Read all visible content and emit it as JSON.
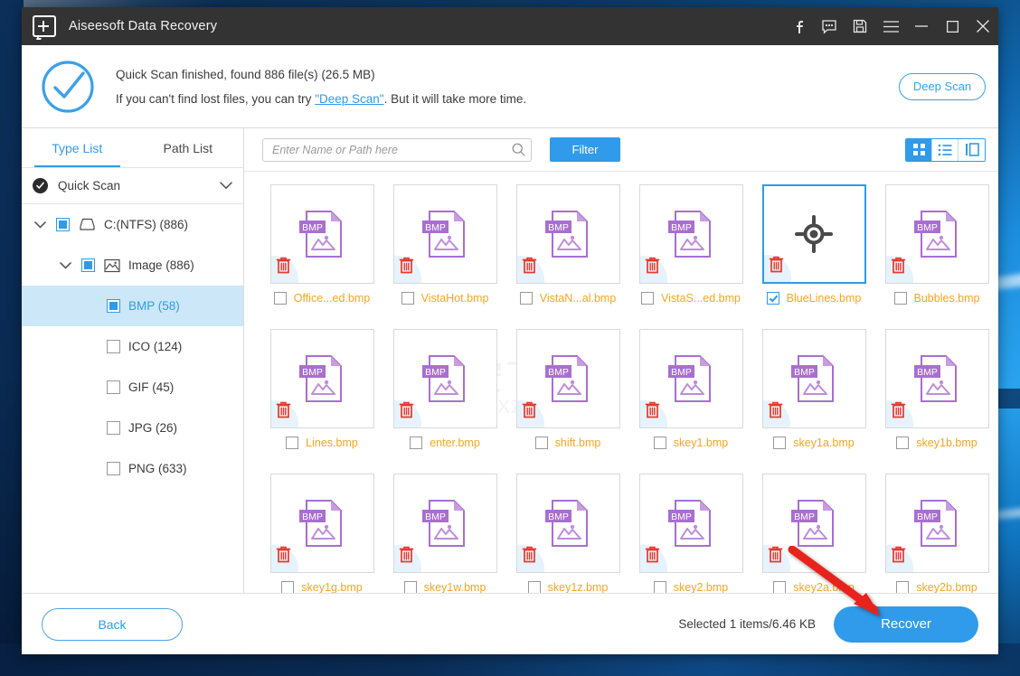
{
  "window": {
    "title": "Aiseesoft Data Recovery",
    "logo_icon": "app-plus-icon",
    "titlebar_buttons": [
      {
        "name": "facebook-icon",
        "label": "f"
      },
      {
        "name": "feedback-icon",
        "label": ""
      },
      {
        "name": "save-icon",
        "label": ""
      },
      {
        "name": "menu-icon",
        "label": ""
      },
      {
        "name": "minimize-icon",
        "label": ""
      },
      {
        "name": "maximize-icon",
        "label": ""
      },
      {
        "name": "close-icon",
        "label": ""
      }
    ]
  },
  "status": {
    "check_icon": "check-circle-icon",
    "line1": "Quick Scan finished, found 886 file(s) (26.5 MB)",
    "line2_before": "If you can't find lost files, you can try ",
    "line2_link": "\"Deep Scan\"",
    "line2_after": ". But it will take more time.",
    "deep_scan_button": "Deep Scan"
  },
  "sidebar": {
    "tabs": [
      {
        "label": "Type List",
        "active": true
      },
      {
        "label": "Path List",
        "active": false
      }
    ],
    "scan_mode": {
      "label": "Quick Scan",
      "check_icon": "check-filled-circle-icon",
      "caret_icon": "chevron-down-icon"
    },
    "tree": [
      {
        "label": "C:(NTFS) (886)",
        "indent": 0,
        "caret": "expanded",
        "check": "partial",
        "icon": "drive-icon",
        "selected": false
      },
      {
        "label": "Image (886)",
        "indent": 1,
        "caret": "expanded",
        "check": "partial",
        "icon": "image-icon",
        "selected": false
      },
      {
        "label": "BMP (58)",
        "indent": 2,
        "caret": "none",
        "check": "partial",
        "icon": "none",
        "selected": true
      },
      {
        "label": "ICO (124)",
        "indent": 2,
        "caret": "none",
        "check": "empty",
        "icon": "none",
        "selected": false
      },
      {
        "label": "GIF (45)",
        "indent": 2,
        "caret": "none",
        "check": "empty",
        "icon": "none",
        "selected": false
      },
      {
        "label": "JPG (26)",
        "indent": 2,
        "caret": "none",
        "check": "empty",
        "icon": "none",
        "selected": false
      },
      {
        "label": "PNG (633)",
        "indent": 2,
        "caret": "none",
        "check": "empty",
        "icon": "none",
        "selected": false
      }
    ]
  },
  "toolbar": {
    "search_placeholder": "Enter Name or Path here",
    "search_value": "",
    "search_icon": "search-icon",
    "filter_label": "Filter",
    "view_modes": [
      {
        "name": "grid-view-icon",
        "active": true
      },
      {
        "name": "list-view-icon",
        "active": false
      },
      {
        "name": "split-view-icon",
        "active": false
      }
    ]
  },
  "files": [
    {
      "name": "Office...ed.bmp",
      "checked": false,
      "selected": false,
      "type": "BMP"
    },
    {
      "name": "VistaHot.bmp",
      "checked": false,
      "selected": false,
      "type": "BMP"
    },
    {
      "name": "VistaN...al.bmp",
      "checked": false,
      "selected": false,
      "type": "BMP"
    },
    {
      "name": "VistaS...ed.bmp",
      "checked": false,
      "selected": false,
      "type": "BMP"
    },
    {
      "name": "BlueLines.bmp",
      "checked": true,
      "selected": true,
      "type": "target"
    },
    {
      "name": "Bubbles.bmp",
      "checked": false,
      "selected": false,
      "type": "BMP"
    },
    {
      "name": "Lines.bmp",
      "checked": false,
      "selected": false,
      "type": "BMP"
    },
    {
      "name": "enter.bmp",
      "checked": false,
      "selected": false,
      "type": "BMP"
    },
    {
      "name": "shift.bmp",
      "checked": false,
      "selected": false,
      "type": "BMP"
    },
    {
      "name": "skey1.bmp",
      "checked": false,
      "selected": false,
      "type": "BMP"
    },
    {
      "name": "skey1a.bmp",
      "checked": false,
      "selected": false,
      "type": "BMP"
    },
    {
      "name": "skey1b.bmp",
      "checked": false,
      "selected": false,
      "type": "BMP"
    },
    {
      "name": "skey1g.bmp",
      "checked": false,
      "selected": false,
      "type": "BMP"
    },
    {
      "name": "skey1w.bmp",
      "checked": false,
      "selected": false,
      "type": "BMP"
    },
    {
      "name": "skey1z.bmp",
      "checked": false,
      "selected": false,
      "type": "BMP"
    },
    {
      "name": "skey2.bmp",
      "checked": false,
      "selected": false,
      "type": "BMP"
    },
    {
      "name": "skey2a.bmp",
      "checked": false,
      "selected": false,
      "type": "BMP"
    },
    {
      "name": "skey2b.bmp",
      "checked": false,
      "selected": false,
      "type": "BMP"
    }
  ],
  "file_icon_label": "BMP",
  "watermark": {
    "cn": "安下载",
    "en": "anxz.com",
    "shield_char": "安"
  },
  "footer": {
    "back_label": "Back",
    "selected_info": "Selected 1 items/6.46 KB",
    "recover_label": "Recover"
  },
  "colors": {
    "accent": "#2f9bea",
    "filename": "#f5a623",
    "titlebar": "#333333",
    "selected_row": "#cce7f8",
    "trash": "#e8392c",
    "bmp_icon": "#a96fd0",
    "arrow": "#e8241a"
  }
}
